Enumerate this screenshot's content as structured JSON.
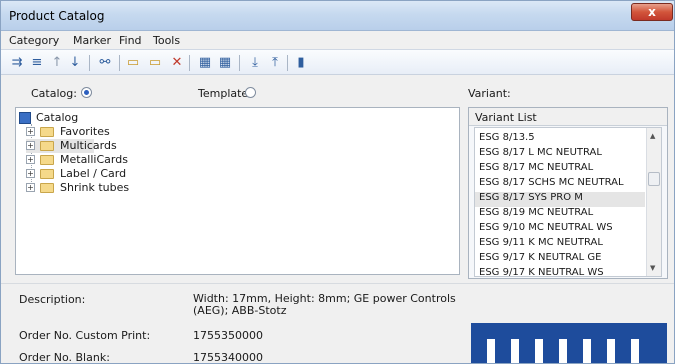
{
  "window": {
    "title": "Product Catalog",
    "close_symbol": "x"
  },
  "menu": [
    "Category",
    "Marker",
    "Find",
    "Tools"
  ],
  "toolbar": {
    "icons": [
      "move-in-icon",
      "list-icon",
      "up-arrow-icon",
      "down-arrow-icon",
      "binoculars-icon",
      "folder-icon",
      "folder-edit-icon",
      "folder-delete-icon",
      "card-add-icon",
      "card-icon",
      "import-icon",
      "export-icon",
      "book-icon"
    ]
  },
  "catalog_radio": {
    "label": "Catalog:",
    "checked": true
  },
  "template_radio": {
    "label": "Template:",
    "checked": false
  },
  "variant_label": "Variant:",
  "tree": {
    "root": "Catalog",
    "children": [
      "Favorites",
      "Multicards",
      "MetalliCards",
      "Label / Card",
      "Shrink tubes"
    ]
  },
  "variant_list": {
    "header": "Variant List",
    "items": [
      "ESG 8/13.5",
      "ESG 8/17 L MC NEUTRAL",
      "ESG 8/17 MC NEUTRAL",
      "ESG 8/17 SCHS MC NEUTRAL",
      "ESG 8/17 SYS PRO M",
      "ESG 8/19 MC NEUTRAL",
      "ESG 9/10 MC NEUTRAL WS",
      "ESG 9/11 K MC NEUTRAL",
      "ESG 9/17 K NEUTRAL GE",
      "ESG 9/17 K NEUTRAL WS"
    ],
    "selected_index": 4
  },
  "details": {
    "description_label": "Description:",
    "description_value": "Width: 17mm, Height: 8mm; GE power Controls (AEG); ABB-Stotz",
    "order_custom_label": "Order No. Custom Print:",
    "order_custom_value": "1755350000",
    "order_blank_label": "Order No. Blank:",
    "order_blank_value": "1755340000"
  },
  "colors": {
    "accent": "#2c5fbf",
    "preview": "#1e4c9c",
    "close": "#c0392b"
  }
}
